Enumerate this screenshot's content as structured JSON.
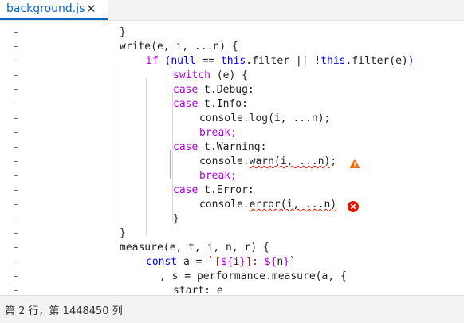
{
  "tab": {
    "label": "background.js",
    "close": "✕"
  },
  "gutter_marker": "-",
  "lines": [
    "}",
    "write(e, i, ...n) {",
    "if (null == this.filter || !this.filter(e))",
    "switch (e) {",
    "case t.Debug:",
    "case t.Info:",
    "console.log(i, ...n);",
    "break;",
    "case t.Warning:",
    "console.warn(i, ...n);",
    "break;",
    "case t.Error:",
    "console.error(i, ...n)",
    "}",
    "}",
    "measure(e, t, i, n, r) {",
    "const a = `[${i}]: ${n}`",
    ", s = performance.measure(a, {",
    "start: e"
  ],
  "status": {
    "text": "第 2 行，第 1448450 列"
  },
  "icons": {
    "warning": "warning-icon",
    "error": "error-icon"
  },
  "colors": {
    "keyword": "#af00db",
    "brace": "#0000ff",
    "string": "#a31515",
    "warning": "#e8711a",
    "error": "#e51400",
    "tab_accent": "#0a66c2"
  }
}
